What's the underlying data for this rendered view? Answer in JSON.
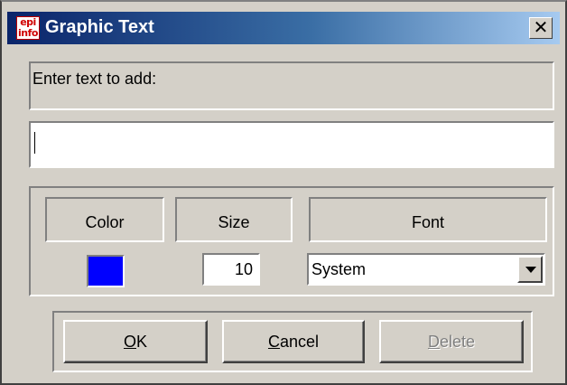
{
  "window": {
    "title": "Graphic Text",
    "icon_text_top": "epi",
    "icon_text_bottom": "info",
    "close_glyph": "✕"
  },
  "prompt": {
    "label": "Enter text to add:"
  },
  "text_input": {
    "value": ""
  },
  "options": {
    "color_label": "Color",
    "size_label": "Size",
    "font_label": "Font",
    "color_value": "#0000ff",
    "size_value": "10",
    "font_value": "System"
  },
  "buttons": {
    "ok": {
      "mnemonic": "O",
      "rest": "K"
    },
    "cancel": {
      "mnemonic": "C",
      "rest": "ancel"
    },
    "delete": {
      "mnemonic": "D",
      "rest": "elete",
      "enabled": false
    }
  },
  "icons": {
    "app": "epi-info-app-icon",
    "close": "close-icon",
    "dropdown": "chevron-down-icon"
  }
}
